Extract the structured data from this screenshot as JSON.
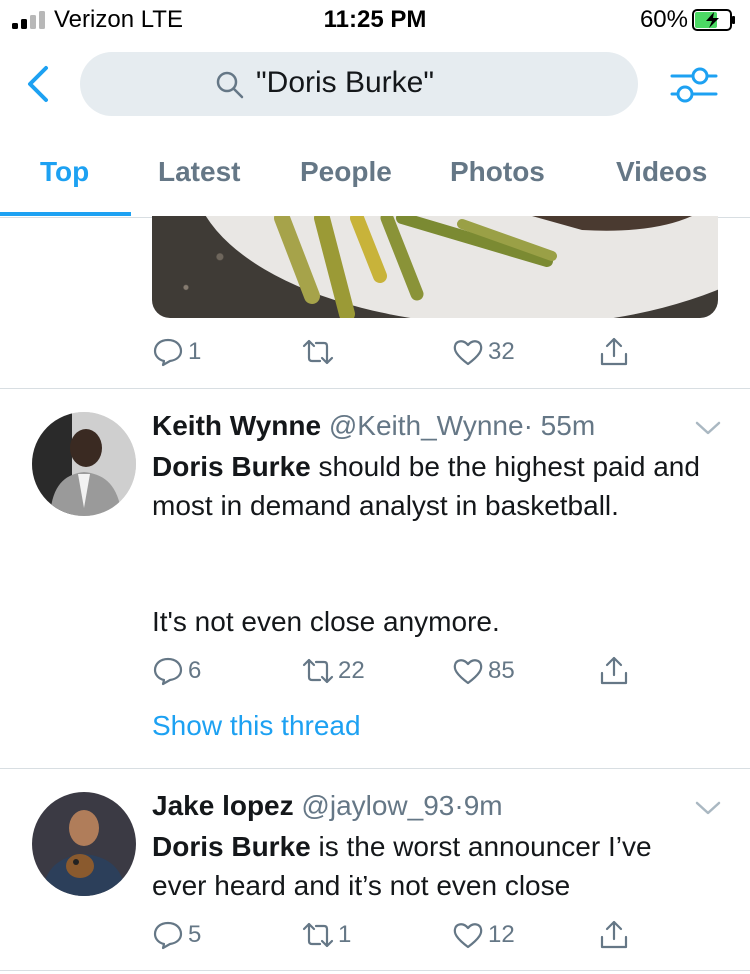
{
  "status_bar": {
    "carrier": "Verizon LTE",
    "time": "11:25 PM",
    "battery_percent": "60%",
    "signal_bars_filled": 2,
    "signal_bars_total": 4,
    "battery_level": 0.6
  },
  "search": {
    "query": "\"Doris Burke\""
  },
  "tabs": [
    {
      "label": "Top",
      "active": true
    },
    {
      "label": "Latest",
      "active": false
    },
    {
      "label": "People",
      "active": false
    },
    {
      "label": "Photos",
      "active": false
    },
    {
      "label": "Videos",
      "active": false
    }
  ],
  "previous_tweet": {
    "reply_count": "1",
    "retweet_count": "",
    "like_count": "32"
  },
  "tweets": [
    {
      "name": "Keith Wynne",
      "handle": "@Keith_Wynne",
      "separator": "·",
      "time": "55m",
      "highlight": "Doris Burke",
      "text_1": " should be the highest paid and most in demand analyst in basketball.",
      "text_2": "It's not even close anymore.",
      "reply_count": "6",
      "retweet_count": "22",
      "like_count": "85",
      "thread_link": "Show this thread"
    },
    {
      "name": "Jake lopez",
      "handle": "@jaylow_93",
      "separator": "·",
      "time": "9m",
      "highlight": "Doris Burke",
      "text_1": " is the worst announcer I’ve ever heard and it’s not even close",
      "reply_count": "5",
      "retweet_count": "1",
      "like_count": "12"
    }
  ],
  "colors": {
    "accent": "#1da1f2",
    "muted": "#657786",
    "text": "#14171a",
    "search_bg": "#e6ecf0",
    "battery_green": "#4cd964"
  },
  "icons": [
    "back-arrow-icon",
    "search-icon",
    "filter-icon",
    "reply-icon",
    "retweet-icon",
    "like-icon",
    "share-icon",
    "caret-down-icon"
  ]
}
